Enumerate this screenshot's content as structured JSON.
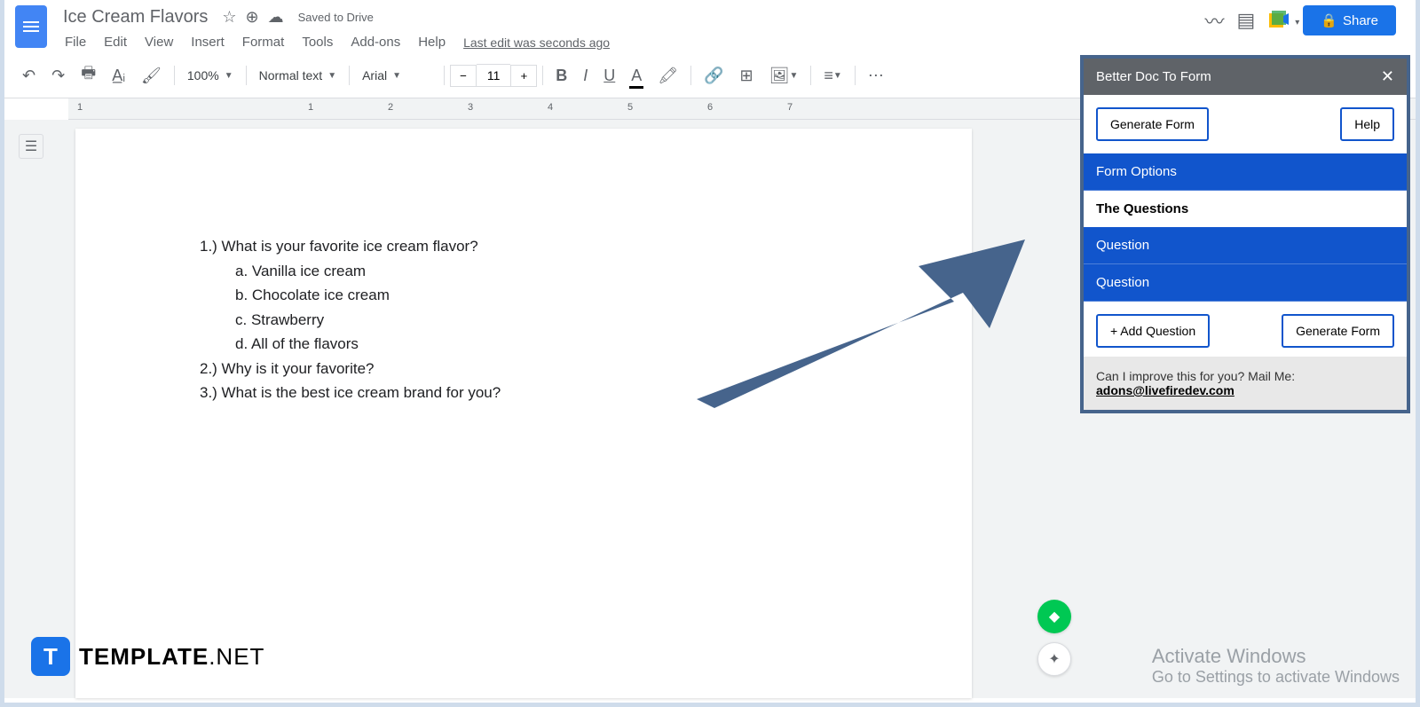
{
  "header": {
    "doc_title": "Ice Cream Flavors",
    "saved_status": "Saved to Drive",
    "last_edit": "Last edit was seconds ago",
    "share_label": "Share"
  },
  "menu": [
    "File",
    "Edit",
    "View",
    "Insert",
    "Format",
    "Tools",
    "Add-ons",
    "Help"
  ],
  "toolbar": {
    "zoom": "100%",
    "style": "Normal text",
    "font": "Arial",
    "font_size": "11"
  },
  "document": {
    "q1": "1.)  What is your favorite ice cream flavor?",
    "q1a": "a.   Vanilla ice cream",
    "q1b": "b.   Chocolate ice cream",
    "q1c": "c.   Strawberry",
    "q1d": "d.   All of the flavors",
    "q2": "2.)  Why is it your favorite?",
    "q3": "3.)  What is the best ice cream brand for you?"
  },
  "addon": {
    "title": "Better Doc To Form",
    "generate": "Generate Form",
    "help": "Help",
    "form_options": "Form Options",
    "the_questions": "The Questions",
    "question": "Question",
    "add_question": "+ Add Question",
    "footer_text": "Can I improve this for you? Mail Me:",
    "footer_email": "adons@livefiredev.com"
  },
  "watermark": {
    "activate_title": "Activate Windows",
    "activate_sub": "Go to Settings to activate Windows",
    "template": "TEMPLATE",
    "template_net": ".NET"
  }
}
